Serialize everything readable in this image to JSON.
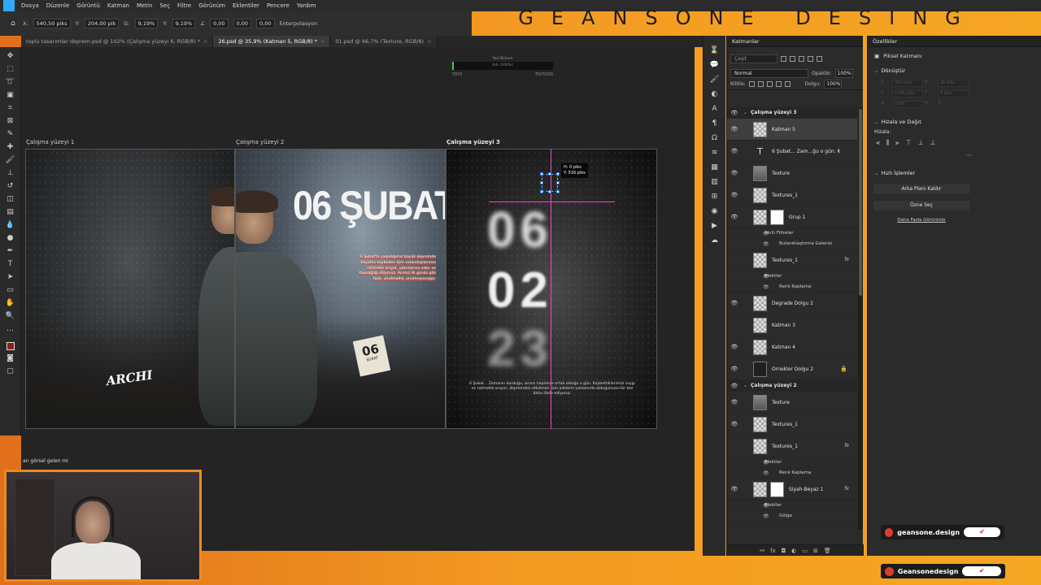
{
  "menubar": {
    "items": [
      "Dosya",
      "Düzenle",
      "Görüntü",
      "Katman",
      "Metin",
      "Seç",
      "Filtre",
      "Görünüm",
      "Eklentiler",
      "Pencere",
      "Yardım"
    ]
  },
  "brand": {
    "banner": "GEANSONE DESING"
  },
  "options": {
    "x_label": "X:",
    "x_value": "540,50 piks",
    "y_label": "Y:",
    "y_value": "204,00 pik",
    "w_label": "G:",
    "w_value": "9,19%",
    "h_label": "Y:",
    "h_value": "9,19%",
    "angle_value": "0,00",
    "hskew_value": "0,00",
    "vskew_value": "0,00",
    "interp": "Enterpolasyon"
  },
  "tabs": [
    {
      "label": "toplu tasarımlar deprem.psd @ 102% (Çalışma yüzeyi 6, RGB/8) *",
      "active": false
    },
    {
      "label": "26.psd @ 35,9% (Katman 5, RGB/8) *",
      "active": true
    },
    {
      "label": "01.psd @ 66,7% (Texture, RGB/8)",
      "active": false
    }
  ],
  "ruler_widget": {
    "caption": "Yeri Bilinen",
    "middle": "Ads (100%)",
    "left": "TRY0",
    "right": "TRY5000"
  },
  "artboards": {
    "ab1_label": "Çalışma yüzeyi 1",
    "ab2_label": "Çalışma yüzeyi 2",
    "ab3_label": "Çalışma yüzeyi 3",
    "ab1_logo": "ARCHI",
    "ab2_title": "06 ŞUBAT",
    "ab2_paragraph": "6 Şubat'ta yaşadığımız büyük depremde hayatını kaybeden tüm vatandaşlarımızı rahmetle anıyor, yakınlarına sabır ve başsağlığı diliyoruz. Acımız ilk günkü gibi taze, unutmadık, unutmayacağız.",
    "ab2_card_day": "06",
    "ab2_card_month": "ŞUBAT",
    "ab3_n1": "06",
    "ab3_n2": "02",
    "ab3_n3": "23",
    "ab3_caption": "6 Şubat... Zamanın durduğu, acının hepimize ortak olduğu o gün. Kaybettiklerimizi saygı ve rahmetle anıyor, depremden etkilenen tüm ailelerin yanlarında olduğumuzu bir kez daha ifade ediyoruz.",
    "tip_line1": "H: 0 piks",
    "tip_line2": "Y: 516 piks"
  },
  "chat": {
    "line": "an görsel gelen mi"
  },
  "layers_panel": {
    "title": "Katmanlar",
    "search_placeholder": "Çeşit",
    "blend_mode": "Normal",
    "opacity_label": "Opaklık:",
    "opacity_value": "100%",
    "lock_label": "Kilitle:",
    "fill_label": "Dolgu:",
    "fill_value": "100%",
    "rows": [
      {
        "kind": "group",
        "name": "Çalışma yüzeyi 3"
      },
      {
        "kind": "layer",
        "name": "Katman 5",
        "thumb": "checker",
        "selected": true
      },
      {
        "kind": "layer",
        "name": "6 Şubat... Zam...ğu o gün. K",
        "thumb": "text"
      },
      {
        "kind": "layer",
        "name": "Texture",
        "thumb": "gray"
      },
      {
        "kind": "layer",
        "name": "Textures_1",
        "thumb": "checker"
      },
      {
        "kind": "layer",
        "name": "Grup 1",
        "thumb": "checker",
        "mask": true
      },
      {
        "kind": "sub",
        "name": "Akıllı Filtreler"
      },
      {
        "kind": "sub2",
        "name": "Bulanıklaştırma Galerisi"
      },
      {
        "kind": "layer",
        "name": "Textures_1",
        "thumb": "checker",
        "fx": "fx"
      },
      {
        "kind": "sub",
        "name": "Efektler"
      },
      {
        "kind": "sub2",
        "name": "Renk Kaplama"
      },
      {
        "kind": "layer",
        "name": "Degrade Dolgu 2",
        "thumb": "checker"
      },
      {
        "kind": "layer",
        "name": "Katman 3",
        "thumb": "checker"
      },
      {
        "kind": "layer",
        "name": "Katman 4",
        "thumb": "checker"
      },
      {
        "kind": "layer",
        "name": "Örnekler Dolgu 2",
        "thumb": "dark",
        "lock": "🔒"
      },
      {
        "kind": "group",
        "name": "Çalışma yüzeyi 2"
      },
      {
        "kind": "layer",
        "name": "Texture",
        "thumb": "gray"
      },
      {
        "kind": "layer",
        "name": "Textures_1",
        "thumb": "checker"
      },
      {
        "kind": "layer",
        "name": "Textures_1",
        "thumb": "checker",
        "fx": "fx"
      },
      {
        "kind": "sub",
        "name": "Efektler"
      },
      {
        "kind": "sub2",
        "name": "Renk Kaplama"
      },
      {
        "kind": "layer",
        "name": "Siyah-Beyaz 1",
        "thumb": "checker",
        "mask": true,
        "fx": "fx"
      },
      {
        "kind": "sub",
        "name": "Efektler"
      },
      {
        "kind": "sub2",
        "name": "Gölge"
      }
    ]
  },
  "properties_panel": {
    "title": "Özellikler",
    "pixel_layer": "Piksel Katmanı",
    "transform_title": "Dönüştür",
    "ghost_w": "960 piks",
    "ghost_x": "36 piks",
    "ghost_h": "1440 piks",
    "ghost_y": "0 piks",
    "ghost_angle": "0,00°",
    "align_title": "Hizala ve Dağıt",
    "align_label": "Hizala:",
    "quick_title": "Hızlı İşlemler",
    "btn_remove_bg": "Arka Planı Kaldır",
    "btn_select_subject": "Özne Seç",
    "link_more": "Daha Fazla Görüntüle"
  },
  "badges": {
    "b1": "geansone.design",
    "b2": "Geansonedesign"
  }
}
